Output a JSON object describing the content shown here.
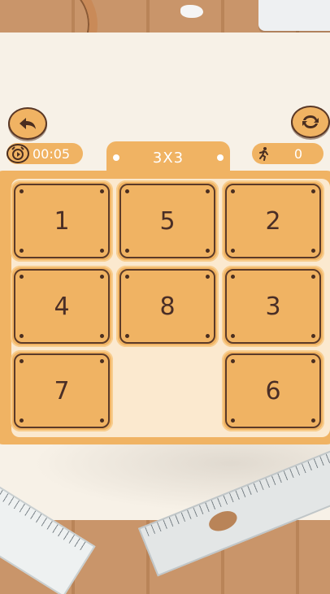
{
  "hud": {
    "timer": "00:05",
    "moves": "0",
    "mode": "3X3"
  },
  "icons": {
    "back": "back-arrow-icon",
    "restart": "restart-icon",
    "timer": "alarm-clock-icon",
    "moves": "running-man-icon"
  },
  "board": {
    "size": 3,
    "cells": [
      "1",
      "5",
      "2",
      "4",
      "8",
      "3",
      "7",
      "",
      "6"
    ]
  },
  "colors": {
    "tile": "#f0b363",
    "tile_text": "#4a2e26",
    "board_bg": "#fbe9cf",
    "paper": "#f7f1e7"
  }
}
